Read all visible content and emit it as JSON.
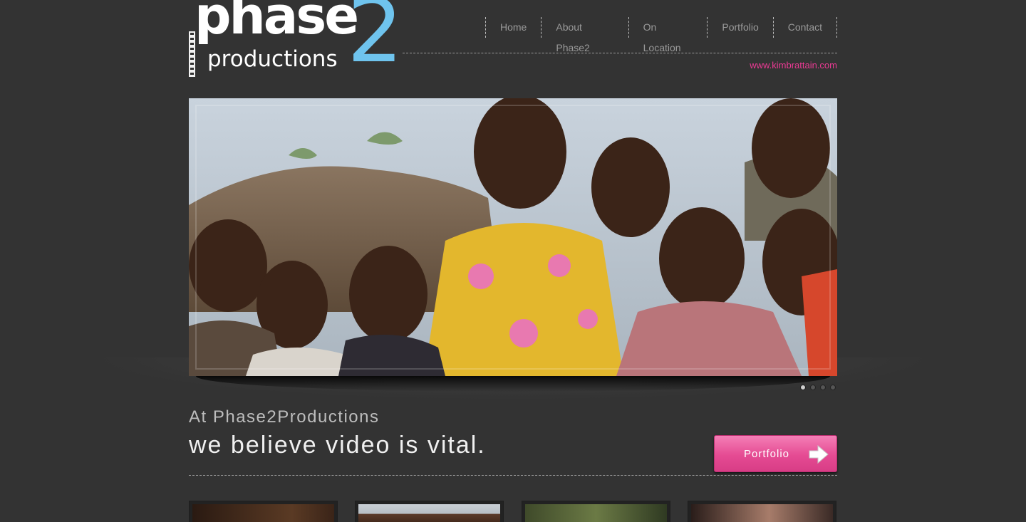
{
  "logo": {
    "phase": "phase",
    "productions": "productions",
    "two": "2"
  },
  "nav": {
    "items": [
      {
        "label": "Home"
      },
      {
        "label": "About Phase2"
      },
      {
        "label": "On Location"
      },
      {
        "label": "Portfolio"
      },
      {
        "label": "Contact"
      }
    ]
  },
  "site_url": "www.kimbrattain.com",
  "slider": {
    "dot_count": 4,
    "active_dot": 1
  },
  "tagline": {
    "small": "At Phase2Productions",
    "big": "we believe video is vital."
  },
  "portfolio_button": {
    "label": "Portfolio"
  },
  "colors": {
    "background": "#333333",
    "accent_pink": "#ec3a94",
    "logo_blue": "#6fc4ee",
    "nav_text": "#9a9a9a"
  }
}
